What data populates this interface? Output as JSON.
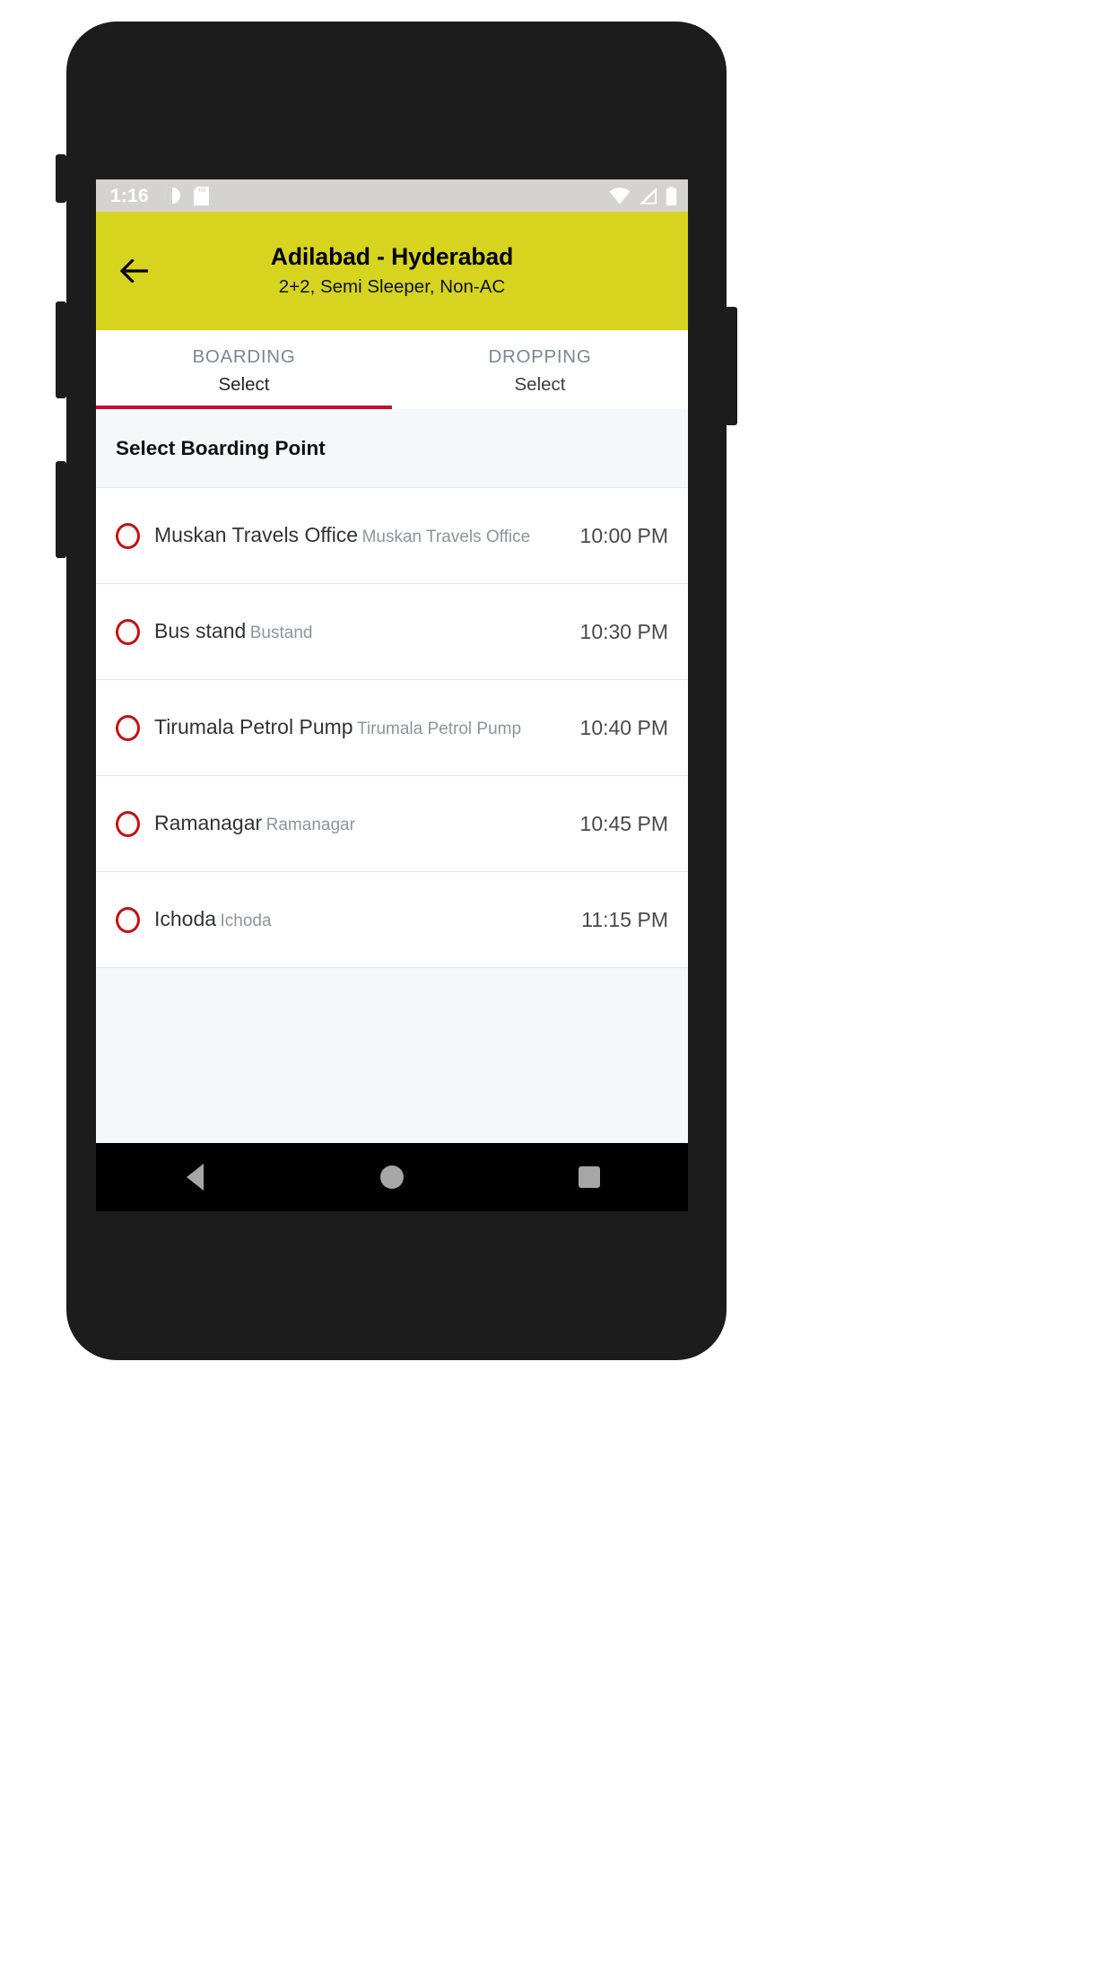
{
  "status_bar": {
    "time": "1:16",
    "left_icons": [
      "alarm-icon",
      "sd-card-icon"
    ],
    "right_icons": [
      "wifi-icon",
      "cellular-signal-icon",
      "battery-icon"
    ],
    "background_color": "#d5d3d1"
  },
  "app_bar": {
    "back_icon": "back-arrow-icon",
    "title": "Adilabad - Hyderabad",
    "subtitle": "2+2, Semi Sleeper, Non-AC",
    "background_color": "#d6d41e"
  },
  "tabs": {
    "active_index": 0,
    "indicator_color": "#c8102e",
    "items": [
      {
        "label": "BOARDING",
        "value": "Select"
      },
      {
        "label": "DROPPING",
        "value": "Select"
      }
    ]
  },
  "section": {
    "title": "Select Boarding Point"
  },
  "boarding_points": [
    {
      "name": "Muskan Travels Office",
      "sub": "Muskan Travels Office",
      "time": "10:00 PM",
      "selected": false
    },
    {
      "name": "Bus stand",
      "sub": "Bustand",
      "time": "10:30 PM",
      "selected": false
    },
    {
      "name": "Tirumala Petrol Pump",
      "sub": "Tirumala Petrol Pump",
      "time": "10:40 PM",
      "selected": false
    },
    {
      "name": "Ramanagar",
      "sub": "Ramanagar",
      "time": "10:45 PM",
      "selected": false
    },
    {
      "name": "Ichoda",
      "sub": "Ichoda",
      "time": "11:15 PM",
      "selected": false
    }
  ],
  "radio": {
    "color": "#cf0a13"
  },
  "nav_bar": {
    "buttons": [
      "back-triangle-icon",
      "home-circle-icon",
      "recents-square-icon"
    ],
    "background_color": "#000000",
    "icon_color": "#a6a6a6"
  }
}
